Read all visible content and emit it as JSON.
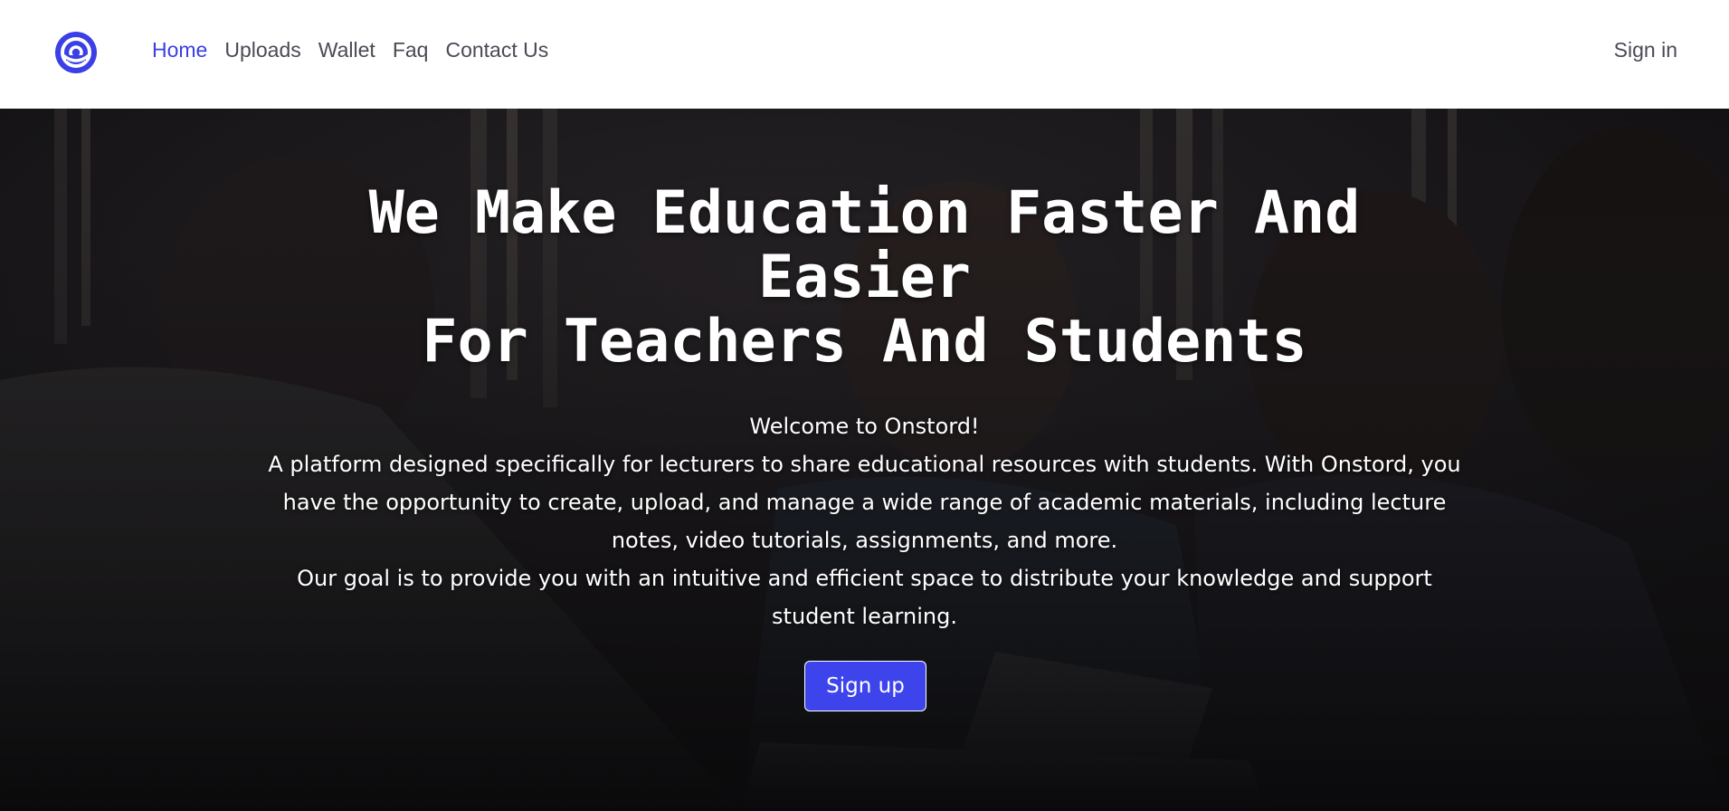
{
  "nav": {
    "logo": "onstord-logo-icon",
    "links": [
      {
        "label": "Home"
      },
      {
        "label": "Uploads"
      },
      {
        "label": "Wallet"
      },
      {
        "label": "Faq"
      },
      {
        "label": "Contact Us"
      }
    ],
    "sign_in": "Sign in"
  },
  "hero": {
    "title_line1": "We Make Education Faster And Easier",
    "title_line2": "For Teachers And Students",
    "welcome": "Welcome to Onstord!",
    "description": "A platform designed specifically for lecturers to share educational resources with students. With Onstord, you have the opportunity to create, upload, and manage a wide range of academic materials, including lecture notes, video tutorials, assignments, and more.",
    "goal": "Our goal is to provide you with an intuitive and efficient space to distribute your knowledge and support student learning.",
    "signup_label": "Sign up"
  },
  "colors": {
    "accent": "#3b3fe6",
    "button": "#3e44ec",
    "nav_text": "#4a4a56"
  }
}
